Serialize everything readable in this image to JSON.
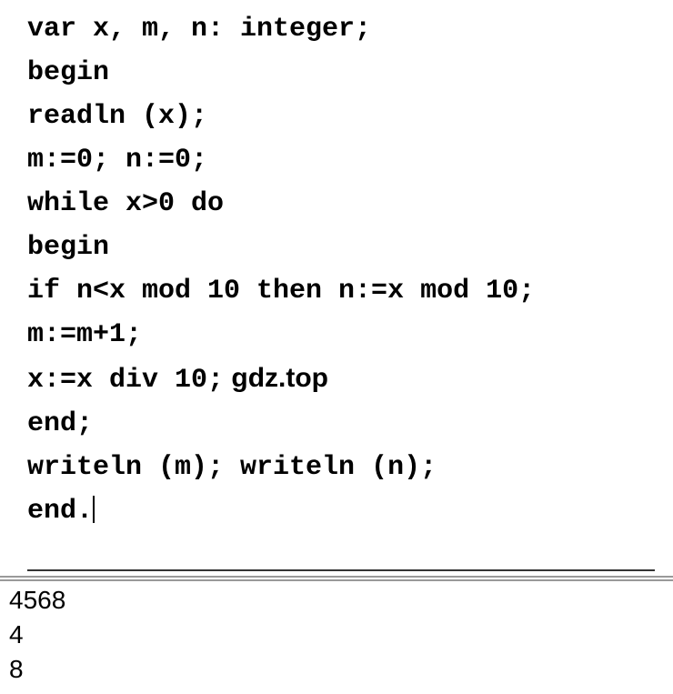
{
  "code": {
    "lines": [
      "var x, m, n: integer;",
      "begin",
      "readln (x);",
      "m:=0; n:=0;",
      "while x>0 do",
      "begin",
      "if n<x mod 10 then n:=x mod 10;",
      "m:=m+1;",
      "x:=x div 10;",
      "end;",
      "writeln (m); writeln (n);",
      "end."
    ]
  },
  "watermark": " gdz.top",
  "output": {
    "lines": [
      "4568",
      "4",
      "8"
    ]
  }
}
